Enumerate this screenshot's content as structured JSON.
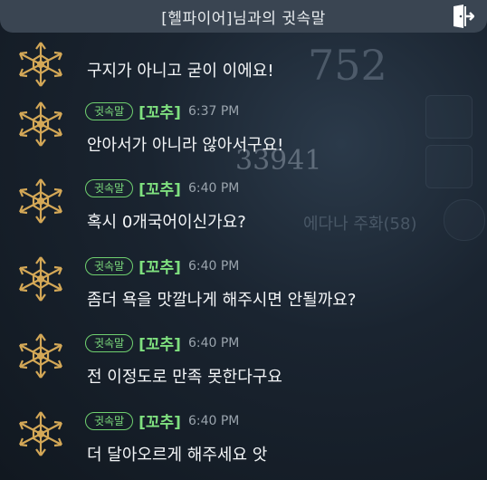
{
  "window": {
    "title": "[헬파이어]님과의 귓속말"
  },
  "messages": [
    {
      "text": "구지가 아니고 굳이 이에요!"
    },
    {
      "badge": "귓속말",
      "sender": "[꼬추]",
      "time": "6:37 PM",
      "text": "안아서가 아니라 않아서구요!"
    },
    {
      "badge": "귓속말",
      "sender": "[꼬추]",
      "time": "6:40 PM",
      "text": "혹시 0개국어이신가요?"
    },
    {
      "badge": "귓속말",
      "sender": "[꼬추]",
      "time": "6:40 PM",
      "text": "좀더 욕을 맛깔나게 해주시면 안될까요?"
    },
    {
      "badge": "귓속말",
      "sender": "[꼬추]",
      "time": "6:40 PM",
      "text": "전 이정도로 만족 못한다구요"
    },
    {
      "badge": "귓속말",
      "sender": "[꼬추]",
      "time": "6:40 PM",
      "text": "더 달아오르게 해주세요 앗"
    }
  ],
  "background": {
    "big_number": "33941",
    "top_number": "752",
    "side_text": "에다나 주화(58)"
  },
  "icons": {
    "exit": "exit-door-icon",
    "avatar": "guild-star-emblem-icon"
  },
  "colors": {
    "whisper_green": "#7fe07f",
    "header": "#3a4552",
    "emblem_gold": "#d4a857"
  }
}
